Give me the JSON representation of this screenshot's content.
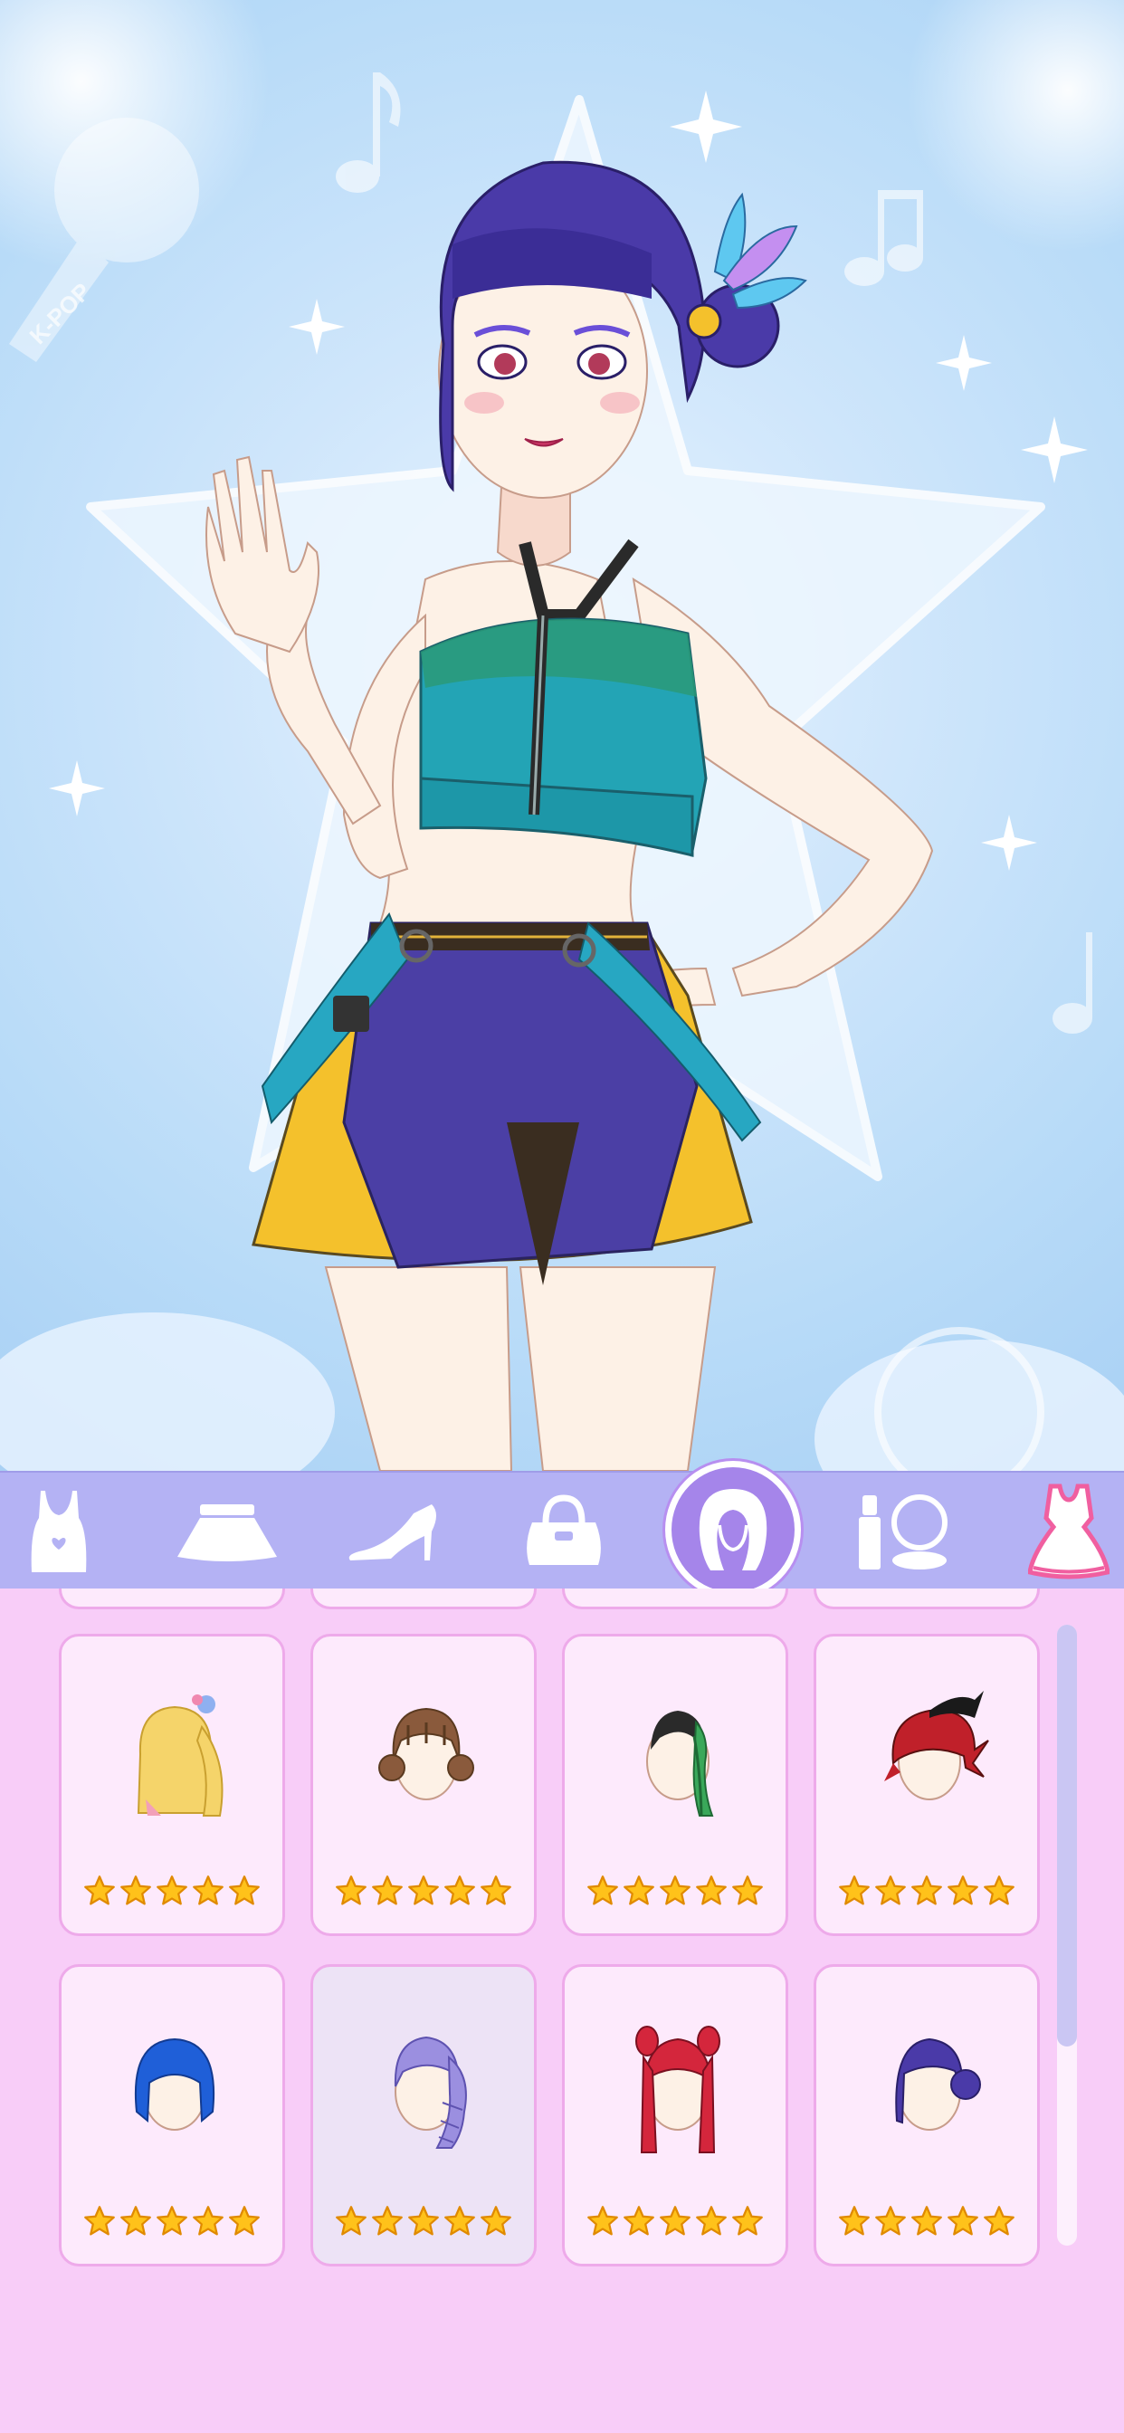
{
  "background": {
    "watermark": "K-POP"
  },
  "category_tabs": [
    {
      "name": "tops",
      "icon": "tank-top-icon",
      "active": false
    },
    {
      "name": "skirts",
      "icon": "skirt-icon",
      "active": false
    },
    {
      "name": "shoes",
      "icon": "high-heel-icon",
      "active": false
    },
    {
      "name": "bags",
      "icon": "handbag-icon",
      "active": false
    },
    {
      "name": "hair",
      "icon": "hair-head-icon",
      "active": true
    },
    {
      "name": "makeup",
      "icon": "lipstick-compact-icon",
      "active": false
    },
    {
      "name": "dresses",
      "icon": "dress-icon",
      "active": false
    }
  ],
  "hair_items": [
    {
      "style": "blonde-side-ponytail",
      "color": "#f5d46a",
      "stars": 5
    },
    {
      "style": "brown-bun",
      "color": "#8a5a3c",
      "stars": 5
    },
    {
      "style": "black-green-braid",
      "color": "#2a2a2a",
      "stars": 5
    },
    {
      "style": "red-black-spiky",
      "color": "#c0202a",
      "stars": 5
    },
    {
      "style": "blue-bob",
      "color": "#1f5fd8",
      "stars": 5
    },
    {
      "style": "lavender-braid",
      "color": "#9b8fe0",
      "stars": 5,
      "selected": true
    },
    {
      "style": "red-twin-tails",
      "color": "#d4263c",
      "stars": 5
    },
    {
      "style": "indigo-bun",
      "color": "#4a3aa8",
      "stars": 5
    }
  ],
  "colors": {
    "bar": "#b4b2f4",
    "panel": "#f8cdf8",
    "active_tab": "#a585ea",
    "star": "#ffc21a"
  }
}
